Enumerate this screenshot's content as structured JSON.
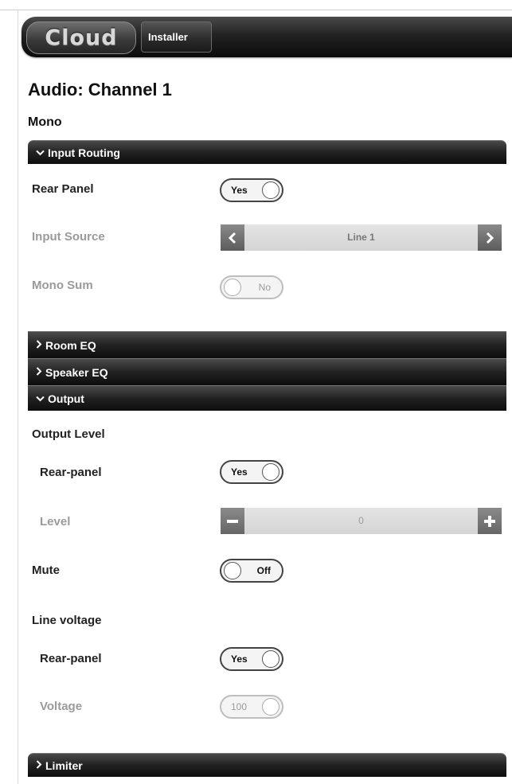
{
  "header": {
    "logo_text": "Cloud",
    "tab_label": "Installer"
  },
  "page": {
    "title": "Audio: Channel 1",
    "mode": "Mono"
  },
  "sections": {
    "input_routing": {
      "label": "Input Routing",
      "expanded": true,
      "rear_panel": {
        "label": "Rear Panel",
        "value": "Yes"
      },
      "input_source": {
        "label": "Input Source",
        "value": "Line 1"
      },
      "mono_sum": {
        "label": "Mono Sum",
        "value": "No"
      }
    },
    "room_eq": {
      "label": "Room EQ",
      "expanded": false
    },
    "speaker_eq": {
      "label": "Speaker EQ",
      "expanded": false
    },
    "output": {
      "label": "Output",
      "expanded": true,
      "output_level": {
        "heading": "Output Level",
        "rear_panel": {
          "label": "Rear-panel",
          "value": "Yes"
        },
        "level": {
          "label": "Level",
          "value": "0"
        }
      },
      "mute": {
        "label": "Mute",
        "value": "Off"
      },
      "line_voltage": {
        "heading": "Line voltage",
        "rear_panel": {
          "label": "Rear-panel",
          "value": "Yes"
        },
        "voltage": {
          "label": "Voltage",
          "value": "100"
        }
      }
    },
    "limiter": {
      "label": "Limiter",
      "expanded": false
    }
  },
  "icons": {
    "expanded": "chevron-down-icon",
    "collapsed": "chevron-right-icon",
    "prev": "arrow-left-icon",
    "next": "arrow-right-icon",
    "minus": "minus-icon",
    "plus": "plus-icon"
  },
  "colors": {
    "bar_dark": "#1a1a1a",
    "disabled_text": "#9a9a9a",
    "selector_bg": "#dcdcdc"
  }
}
